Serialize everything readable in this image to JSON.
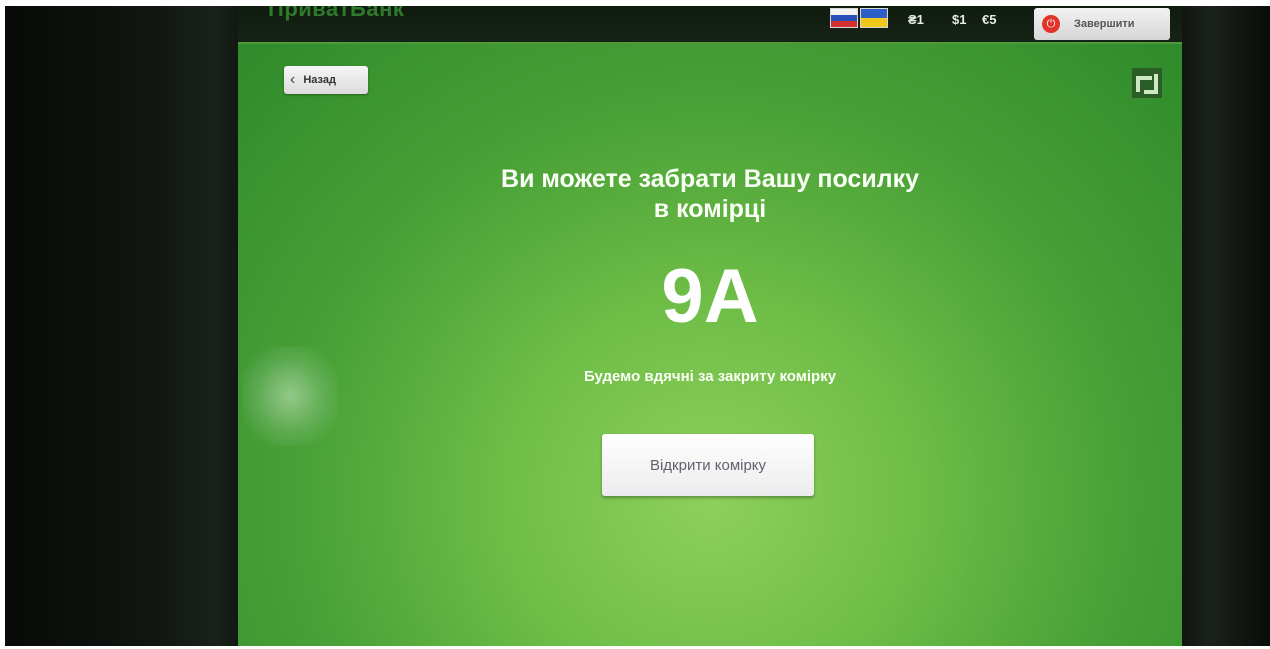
{
  "topbar": {
    "logo_text": "ПриватБанк",
    "flags": [
      {
        "icon": "russian-flag-icon"
      },
      {
        "icon": "ukrainian-flag-icon"
      }
    ],
    "balances": [
      "₴1",
      "$1",
      "€5"
    ],
    "finish_label": "Завершити",
    "finish_icon": "power-icon"
  },
  "nav": {
    "back_label": "Назад",
    "back_icon": "chevron-left-icon",
    "brand_icon": "privatbank-logo-icon"
  },
  "main": {
    "headline_line1": "Ви можете забрати Вашу посилку",
    "headline_line2": "в комірці",
    "cell_number": "9A",
    "thanks_text": "Будемо вдячні за закриту комірку",
    "open_button_label": "Відкрити комірку"
  },
  "colors": {
    "screen_green": "#48a036",
    "power_red": "#e0352b"
  }
}
